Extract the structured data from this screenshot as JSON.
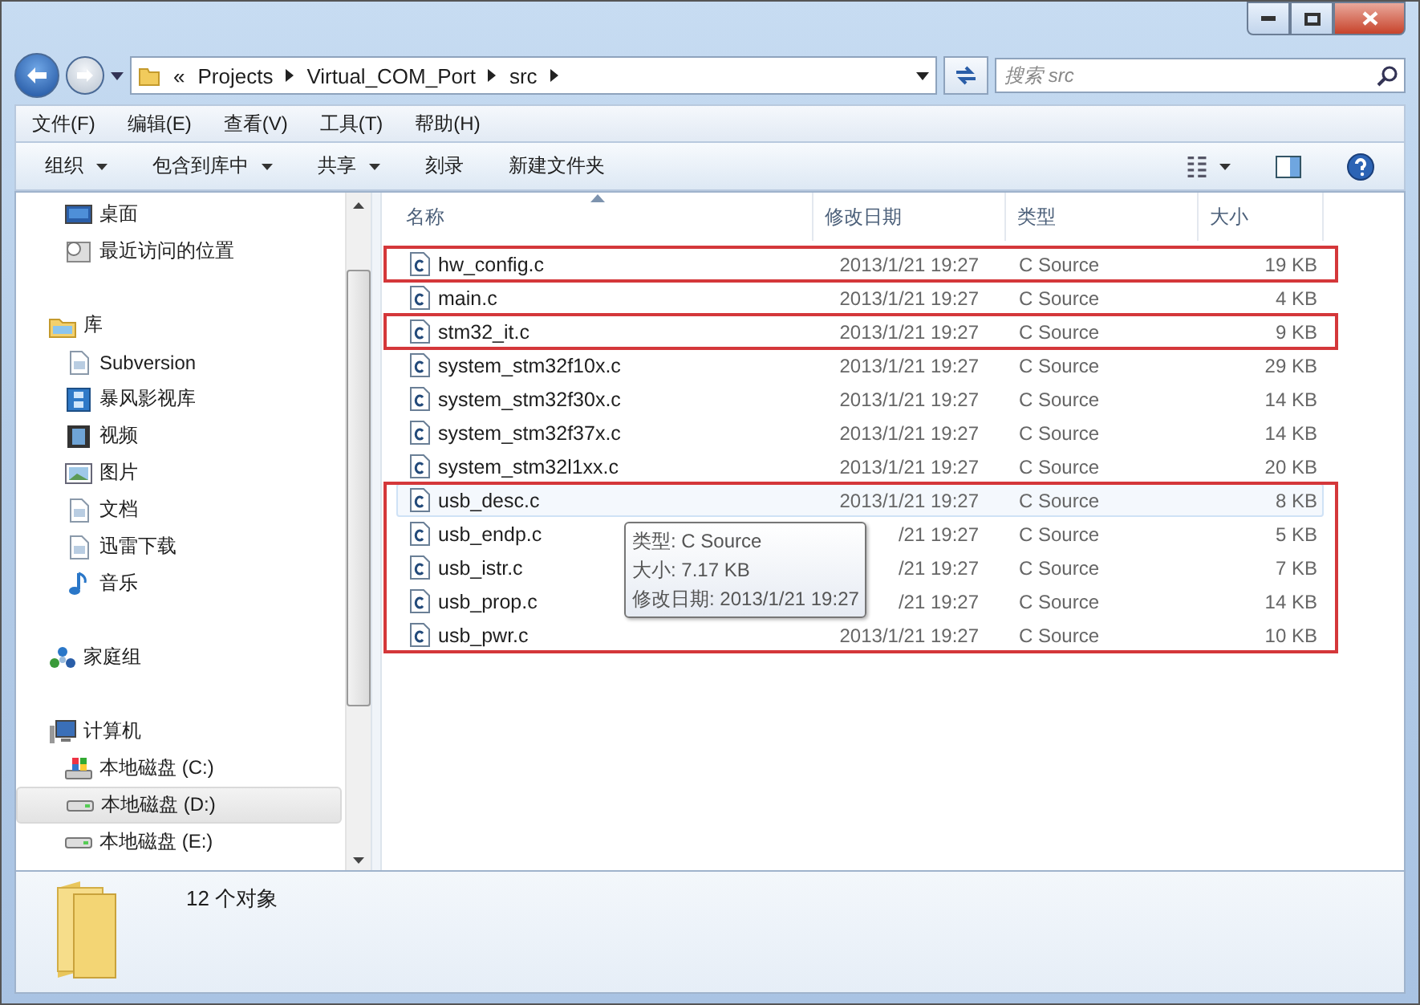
{
  "address_bar": {
    "overflow": "«",
    "crumbs": [
      "Projects",
      "Virtual_COM_Port",
      "src"
    ]
  },
  "search": {
    "placeholder": "搜索 src"
  },
  "menu": [
    "文件(F)",
    "编辑(E)",
    "查看(V)",
    "工具(T)",
    "帮助(H)"
  ],
  "toolbar": [
    {
      "label": "组织",
      "dropdown": true
    },
    {
      "label": "包含到库中",
      "dropdown": true
    },
    {
      "label": "共享",
      "dropdown": true
    },
    {
      "label": "刻录",
      "dropdown": false
    },
    {
      "label": "新建文件夹",
      "dropdown": false
    }
  ],
  "sidebar": {
    "groups": [
      {
        "children": [
          {
            "label": "桌面",
            "kind": "desktop",
            "selected": false
          },
          {
            "label": "最近访问的位置",
            "kind": "recent",
            "selected": false
          }
        ]
      },
      {
        "label": "库",
        "kind": "library",
        "children": [
          {
            "label": "Subversion",
            "kind": "document",
            "selected": false
          },
          {
            "label": "暴风影视库",
            "kind": "video-library",
            "selected": false
          },
          {
            "label": "视频",
            "kind": "video",
            "selected": false
          },
          {
            "label": "图片",
            "kind": "pictures",
            "selected": false
          },
          {
            "label": "文档",
            "kind": "document",
            "selected": false
          },
          {
            "label": "迅雷下载",
            "kind": "document",
            "selected": false
          },
          {
            "label": "音乐",
            "kind": "music",
            "selected": false
          }
        ]
      },
      {
        "label": "家庭组",
        "kind": "homegroup"
      },
      {
        "label": "计算机",
        "kind": "computer",
        "children": [
          {
            "label": "本地磁盘 (C:)",
            "kind": "system-drive",
            "selected": false
          },
          {
            "label": "本地磁盘 (D:)",
            "kind": "drive",
            "selected": true
          },
          {
            "label": "本地磁盘 (E:)",
            "kind": "drive",
            "selected": false
          }
        ]
      }
    ]
  },
  "file_list": {
    "columns": [
      {
        "label": "名称",
        "sorted": true
      },
      {
        "label": "修改日期",
        "sorted": false
      },
      {
        "label": "类型",
        "sorted": false
      },
      {
        "label": "大小",
        "sorted": false
      }
    ],
    "groups": [
      {
        "highlighted": true,
        "rows": [
          {
            "name": "hw_config.c",
            "date": "2013/1/21 19:27",
            "type": "C Source",
            "size": "19 KB",
            "hovered": false
          }
        ]
      },
      {
        "highlighted": false,
        "rows": [
          {
            "name": "main.c",
            "date": "2013/1/21 19:27",
            "type": "C Source",
            "size": "4 KB",
            "hovered": false
          }
        ]
      },
      {
        "highlighted": true,
        "rows": [
          {
            "name": "stm32_it.c",
            "date": "2013/1/21 19:27",
            "type": "C Source",
            "size": "9 KB",
            "hovered": false
          }
        ]
      },
      {
        "highlighted": false,
        "rows": [
          {
            "name": "system_stm32f10x.c",
            "date": "2013/1/21 19:27",
            "type": "C Source",
            "size": "29 KB",
            "hovered": false
          },
          {
            "name": "system_stm32f30x.c",
            "date": "2013/1/21 19:27",
            "type": "C Source",
            "size": "14 KB",
            "hovered": false
          },
          {
            "name": "system_stm32f37x.c",
            "date": "2013/1/21 19:27",
            "type": "C Source",
            "size": "14 KB",
            "hovered": false
          },
          {
            "name": "system_stm32l1xx.c",
            "date": "2013/1/21 19:27",
            "type": "C Source",
            "size": "20 KB",
            "hovered": false
          }
        ]
      },
      {
        "highlighted": true,
        "rows": [
          {
            "name": "usb_desc.c",
            "date": "2013/1/21 19:27",
            "type": "C Source",
            "size": "8 KB",
            "hovered": true
          },
          {
            "name": "usb_endp.c",
            "date": "/21 19:27",
            "type": "C Source",
            "size": "5 KB",
            "hovered": false
          },
          {
            "name": "usb_istr.c",
            "date": "/21 19:27",
            "type": "C Source",
            "size": "7 KB",
            "hovered": false
          },
          {
            "name": "usb_prop.c",
            "date": "/21 19:27",
            "type": "C Source",
            "size": "14 KB",
            "hovered": false
          },
          {
            "name": "usb_pwr.c",
            "date": "2013/1/21 19:27",
            "type": "C Source",
            "size": "10 KB",
            "hovered": false
          }
        ]
      }
    ]
  },
  "tooltip": {
    "lines": [
      "类型: C Source",
      "大小: 7.17 KB",
      "修改日期: 2013/1/21 19:27"
    ]
  },
  "details": {
    "count": "12 个对象"
  }
}
